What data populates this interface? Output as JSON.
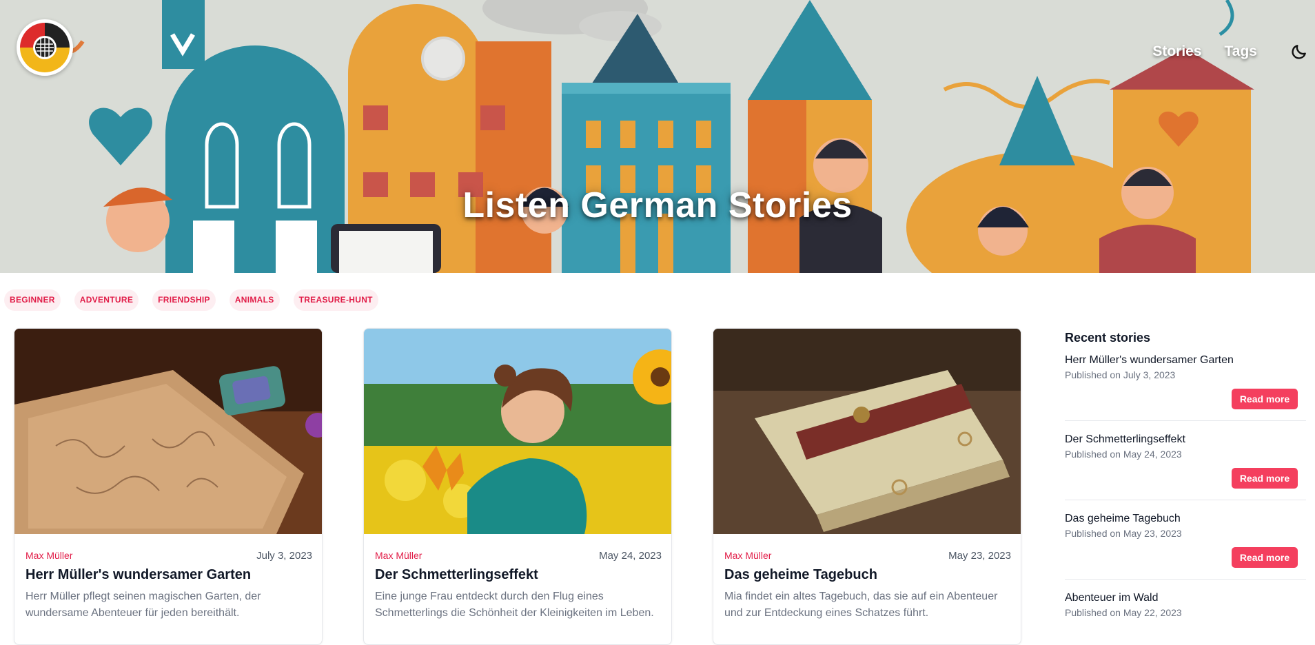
{
  "hero": {
    "title": "Listen German Stories"
  },
  "nav": {
    "items": [
      {
        "label": "Stories"
      },
      {
        "label": "Tags"
      }
    ]
  },
  "tags": [
    "BEGINNER",
    "ADVENTURE",
    "FRIENDSHIP",
    "ANIMALS",
    "TREASURE-HUNT"
  ],
  "cards": [
    {
      "author": "Max Müller",
      "date": "July 3, 2023",
      "title": "Herr Müller's wundersamer Garten",
      "description": "Herr Müller pflegt seinen magischen Garten, der wundersame Abenteuer für jeden bereithält."
    },
    {
      "author": "Max Müller",
      "date": "May 24, 2023",
      "title": "Der Schmetterlingseffekt",
      "description": "Eine junge Frau entdeckt durch den Flug eines Schmetterlings die Schönheit der Kleinigkeiten im Leben."
    },
    {
      "author": "Max Müller",
      "date": "May 23, 2023",
      "title": "Das geheime Tagebuch",
      "description": "Mia findet ein altes Tagebuch, das sie auf ein Abenteuer und zur Entdeckung eines Schatzes führt."
    }
  ],
  "sidebar": {
    "title": "Recent stories",
    "read_more_label": "Read more",
    "items": [
      {
        "title": "Herr Müller's wundersamer Garten",
        "date": "Published on July 3, 2023"
      },
      {
        "title": "Der Schmetterlingseffekt",
        "date": "Published on May 24, 2023"
      },
      {
        "title": "Das geheime Tagebuch",
        "date": "Published on May 23, 2023"
      },
      {
        "title": "Abenteuer im Wald",
        "date": "Published on May 22, 2023"
      }
    ]
  },
  "colors": {
    "accent": "#e11d48",
    "button": "#f43f5e",
    "tag_bg": "#fdeef1"
  }
}
